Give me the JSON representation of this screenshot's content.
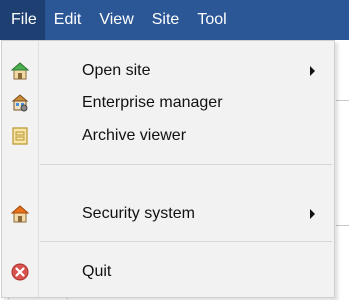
{
  "menubar": {
    "items": [
      {
        "label": "File",
        "active": true
      },
      {
        "label": "Edit",
        "active": false
      },
      {
        "label": "View",
        "active": false
      },
      {
        "label": "Site",
        "active": false
      },
      {
        "label": "Tool",
        "active": false
      }
    ]
  },
  "file_menu": {
    "items": [
      {
        "label": "Open site",
        "icon": "house-icon",
        "has_submenu": true
      },
      {
        "label": "Enterprise manager",
        "icon": "enterprise-icon",
        "has_submenu": false
      },
      {
        "label": "Archive viewer",
        "icon": "archive-icon",
        "has_submenu": false
      },
      {
        "label": "Security system",
        "icon": "house-icon",
        "has_submenu": true
      },
      {
        "label": "Quit",
        "icon": "quit-icon",
        "has_submenu": false
      }
    ]
  },
  "colors": {
    "menubar_bg": "#2b5797",
    "menubar_active_bg": "#1d3f72",
    "menu_bg": "#f2f2f2",
    "quit_icon_red": "#d9534f"
  }
}
